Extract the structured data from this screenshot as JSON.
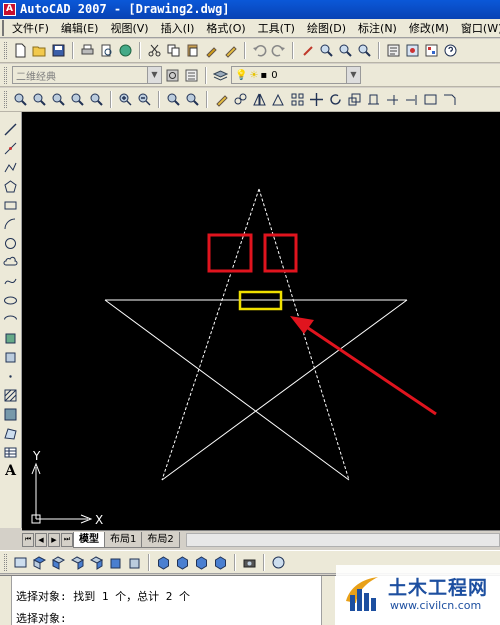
{
  "window": {
    "app_icon_letter": "A",
    "title": "AutoCAD 2007 - [Drawing2.dwg]"
  },
  "menu": [
    "文件(F)",
    "编辑(E)",
    "视图(V)",
    "插入(I)",
    "格式(O)",
    "工具(T)",
    "绘图(D)",
    "标注(N)",
    "修改(M)",
    "窗口(W)"
  ],
  "workspace_combo": {
    "value": "二维经典"
  },
  "layer_combo": {
    "value": "0"
  },
  "canvas": {
    "ucs_y_label": "Y",
    "ucs_x_label": "X",
    "colors": {
      "background": "#000000",
      "star": "#ffffff",
      "highlight_red": "#e0141e",
      "highlight_yellow": "#f0e000",
      "arrow": "#e0141e"
    }
  },
  "layout_tabs": [
    "模型",
    "布局1",
    "布局2"
  ],
  "command_line": {
    "line1": "选择对象: 找到 1 个，总计 2 个",
    "line2": "选择对象:"
  },
  "watermark": {
    "title": "土木工程网",
    "url": "www.civilcn.com"
  },
  "icons": {
    "top_toolbar": [
      "new-icon",
      "open-icon",
      "save-icon",
      "print-icon",
      "preview-icon",
      "publish-icon",
      "cut-icon",
      "copy-icon",
      "paste-icon",
      "match-properties-icon",
      "block-editor-icon",
      "undo-icon",
      "redo-icon",
      "pan-icon",
      "zoom-realtime-icon",
      "zoom-window-icon",
      "zoom-previous-icon",
      "properties-icon",
      "design-center-icon",
      "tool-palettes-icon",
      "help-icon"
    ],
    "left_toolbar": [
      "line-icon",
      "construction-line-icon",
      "polyline-icon",
      "polygon-icon",
      "rectangle-icon",
      "arc-icon",
      "circle-icon",
      "revision-cloud-icon",
      "spline-icon",
      "ellipse-icon",
      "ellipse-arc-icon",
      "insert-block-icon",
      "make-block-icon",
      "point-icon",
      "hatch-icon",
      "gradient-icon",
      "region-icon",
      "table-icon",
      "multiline-text-icon"
    ]
  }
}
